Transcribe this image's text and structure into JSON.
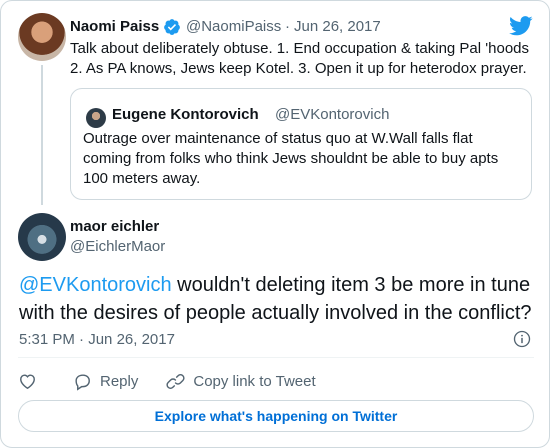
{
  "parent_tweet": {
    "author_name": "Naomi Paiss",
    "author_handle": "@NaomiPaiss",
    "separator": "·",
    "date": "Jun 26, 2017",
    "text_line1": "Talk about deliberately obtuse. 1. End occupation & taking Pal 'hoods",
    "text_line2": "2. As PA knows, Jews keep Kotel. 3. Open it up for heterodox prayer."
  },
  "quoted_tweet": {
    "author_name": "Eugene Kontorovich",
    "author_handle": "@EVKontorovich",
    "text_line1": "Outrage over maintenance of status quo at W.Wall falls flat",
    "text_line2": "coming from folks who think Jews shouldnt be able to buy apts",
    "text_line3": "100 meters away."
  },
  "main_tweet": {
    "author_name": "maor eichler",
    "author_handle": "@EichlerMaor",
    "mention": "@EVKontorovich",
    "text_line1_rest": " wouldn't deleting item 3 be more in tune",
    "text_line2": "with the desires of people actually involved in the conflict?",
    "time": "5:31 PM",
    "separator": "·",
    "date": "Jun 26, 2017"
  },
  "actions": {
    "like_icon": "heart-icon",
    "reply_label": "Reply",
    "copy_link_label": "Copy link to Tweet"
  },
  "explore_button_label": "Explore what's happening on Twitter",
  "colors": {
    "accent": "#1d9bf0",
    "muted": "#536471",
    "border": "#cfd9de",
    "explore_text": "#006fd6"
  }
}
